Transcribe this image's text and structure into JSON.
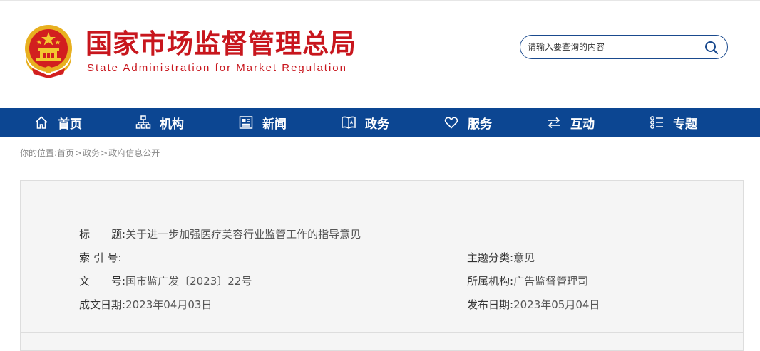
{
  "site": {
    "title_cn": "国家市场监督管理总局",
    "title_en": "State Administration for Market Regulation"
  },
  "search": {
    "placeholder": "请输入要查询的内容"
  },
  "nav": {
    "items": [
      {
        "label": "首页",
        "icon": "home-icon"
      },
      {
        "label": "机构",
        "icon": "org-chart-icon"
      },
      {
        "label": "新闻",
        "icon": "news-icon"
      },
      {
        "label": "政务",
        "icon": "book-icon"
      },
      {
        "label": "服务",
        "icon": "heart-icon"
      },
      {
        "label": "互动",
        "icon": "exchange-icon"
      },
      {
        "label": "专题",
        "icon": "list-icon"
      }
    ]
  },
  "breadcrumb": {
    "prefix": "你的位置:",
    "items": [
      "首页",
      "政务",
      "政府信息公开"
    ],
    "separator": ">"
  },
  "document": {
    "title_label": "标　　题:",
    "title_value": "关于进一步加强医疗美容行业监管工作的指导意见",
    "index_label": "索 引 号:",
    "index_value": "",
    "topic_label": "主题分类:",
    "topic_value": "意见",
    "docno_label": "文　　号:",
    "docno_value": "国市监广发〔2023〕22号",
    "org_label": "所属机构:",
    "org_value": "广告监督管理司",
    "created_label": "成文日期:",
    "created_value": "2023年04月03日",
    "published_label": "发布日期:",
    "published_value": "2023年05月04日"
  },
  "colors": {
    "brand_red": "#c8161d",
    "nav_blue": "#0c4692",
    "search_border": "#1a4a8e"
  }
}
